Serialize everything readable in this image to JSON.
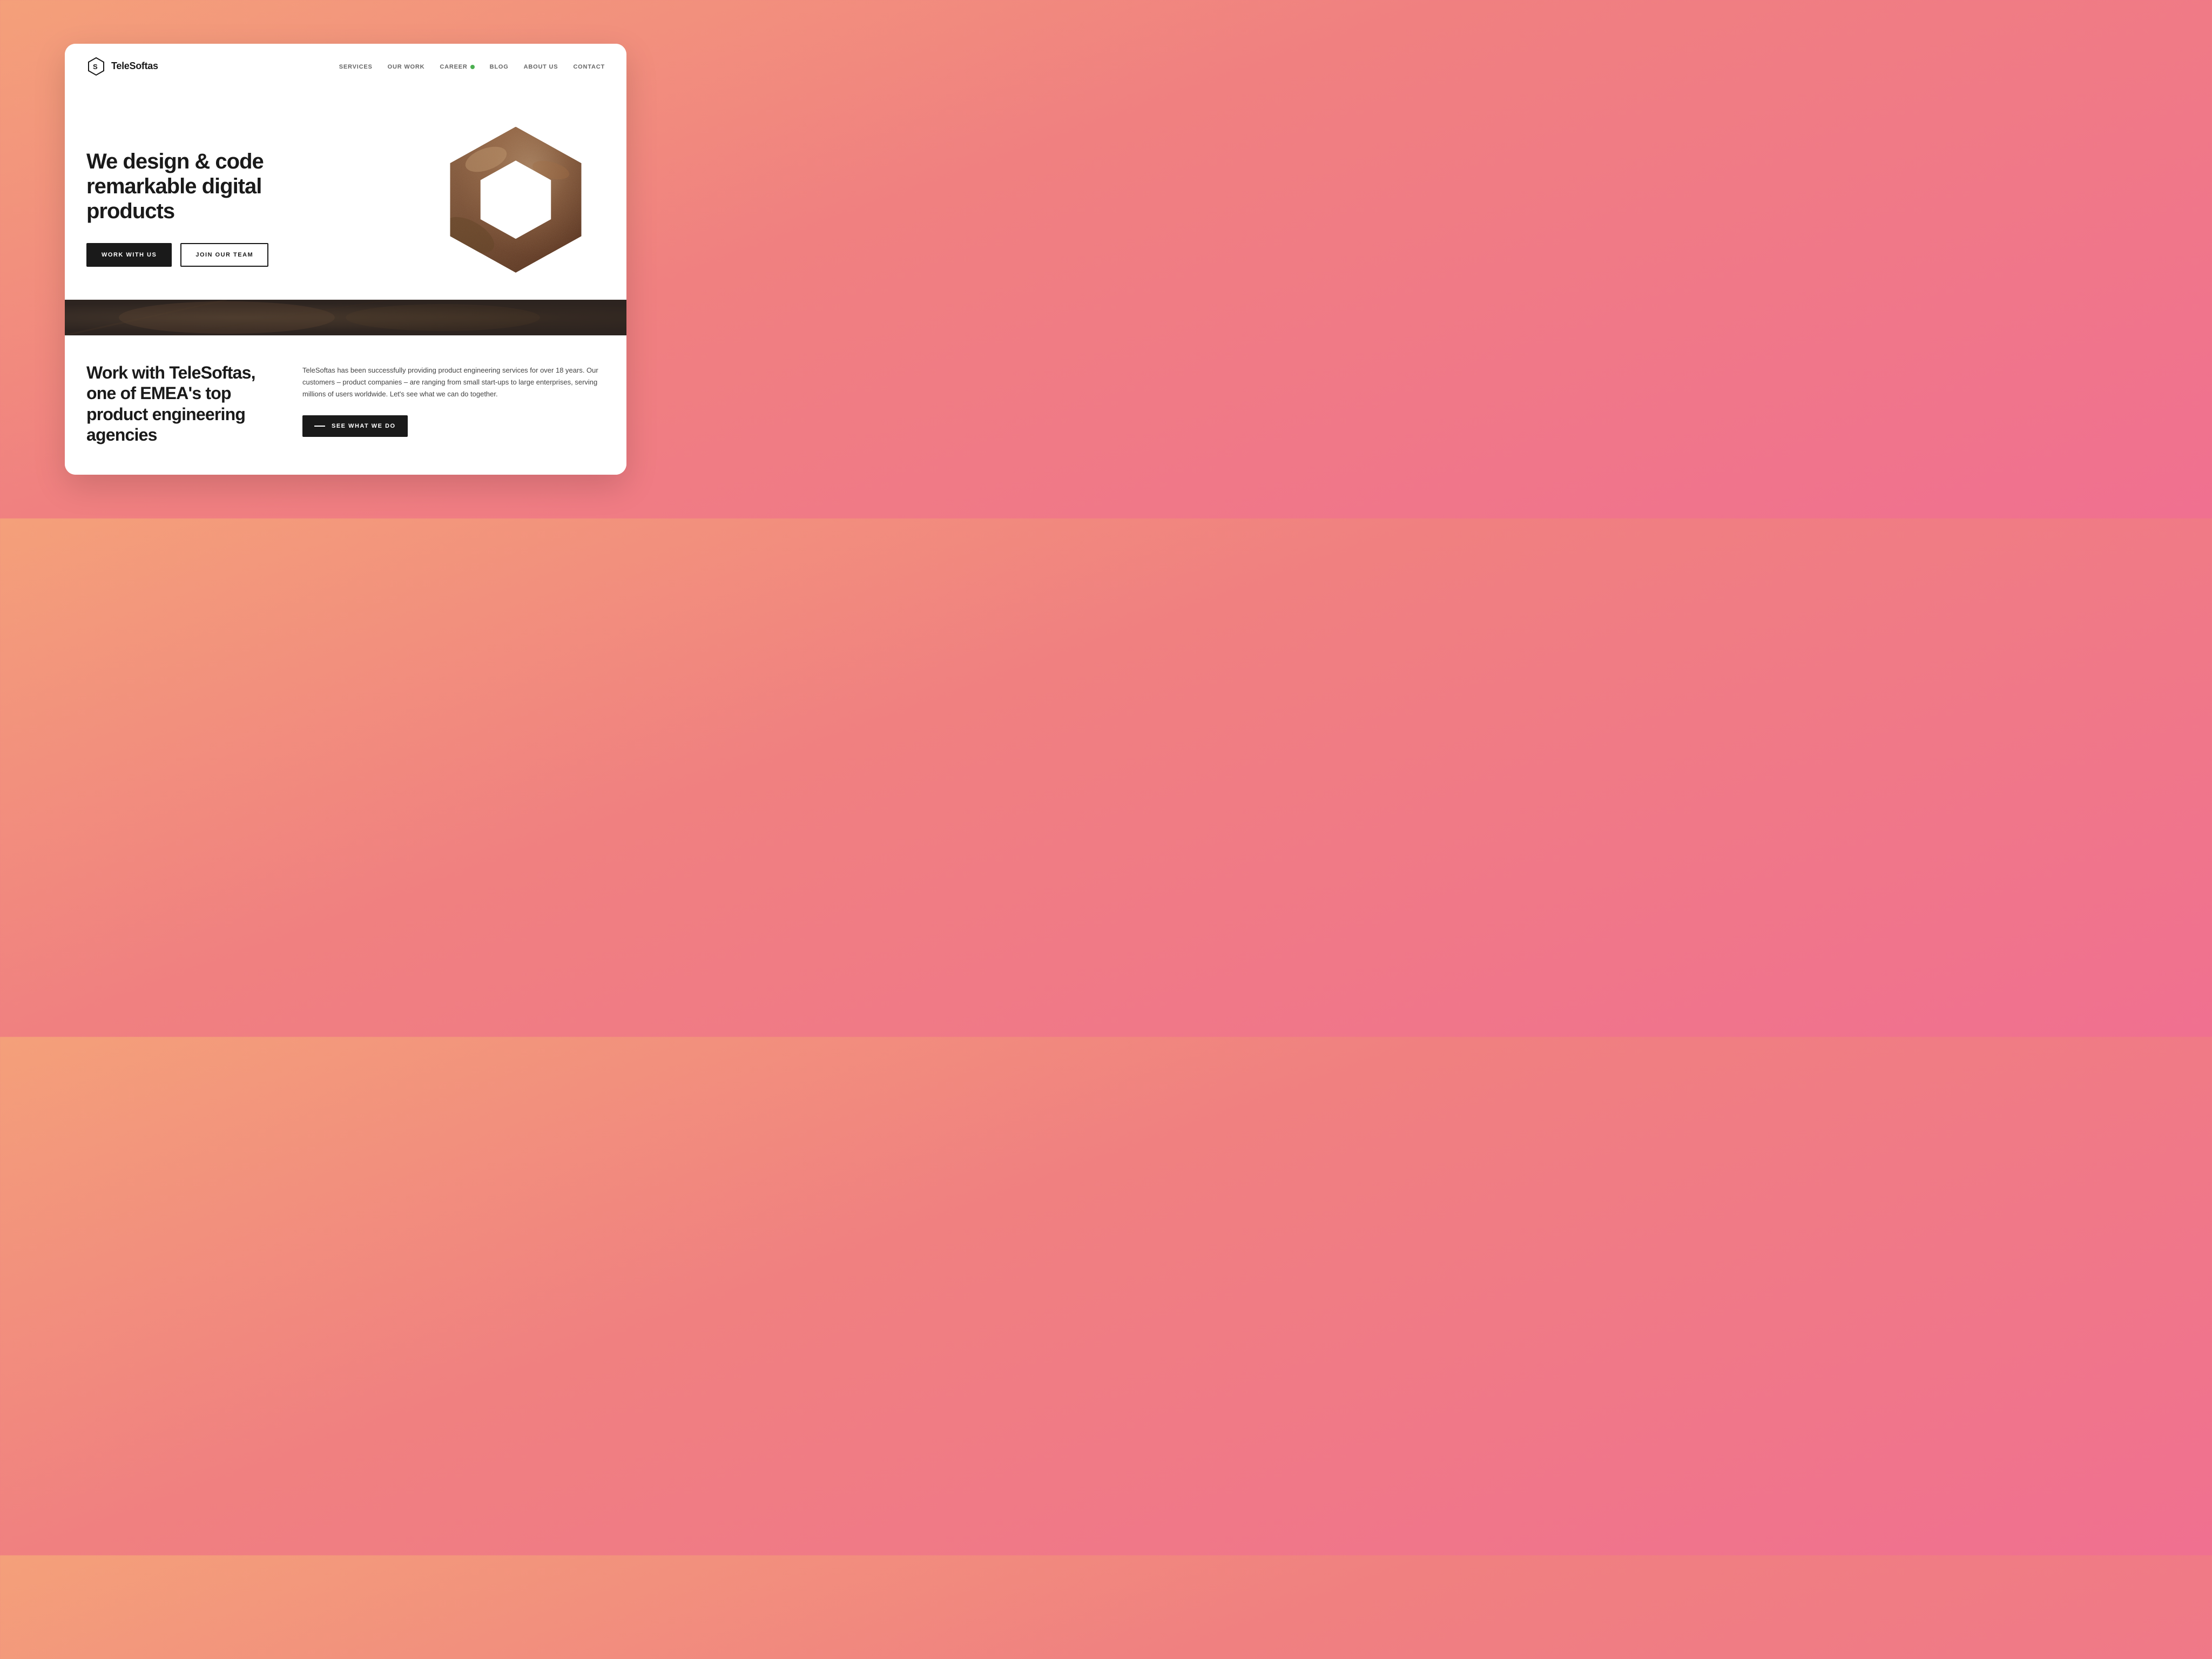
{
  "logo": {
    "text": "TeleSoftas"
  },
  "nav": {
    "links": [
      {
        "id": "services",
        "label": "SERVICES"
      },
      {
        "id": "our-work",
        "label": "OUR WORK"
      },
      {
        "id": "career",
        "label": "CAREER",
        "badge": true
      },
      {
        "id": "blog",
        "label": "BLOG"
      },
      {
        "id": "about-us",
        "label": "ABOUT US"
      },
      {
        "id": "contact",
        "label": "CONTACT"
      }
    ]
  },
  "hero": {
    "title": "We design & code remarkable digital products",
    "btn_primary": "WORK WITH US",
    "btn_secondary": "JOIN OUR TEAM"
  },
  "about": {
    "title": "Work with TeleSoftas, one of EMEA's top product engineering agencies",
    "description": "TeleSoftas has been successfully providing product engineering services for over 18 years. Our customers – product companies – are ranging from small start-ups to large enterprises, serving millions of users worldwide. Let's see what we can do together.",
    "btn_label": "SEE WHAT WE DO"
  }
}
